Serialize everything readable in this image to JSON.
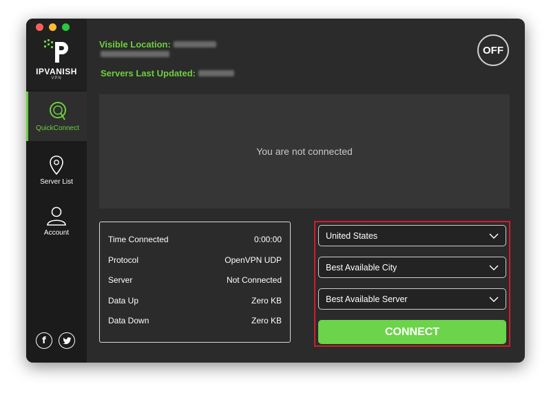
{
  "window": {
    "controls": [
      "close",
      "minimize",
      "zoom"
    ]
  },
  "brand": {
    "name": "IPVANISH",
    "sub": "VPN",
    "accent": "#6fcf3f"
  },
  "sidebar": {
    "items": [
      {
        "label": "QuickConnect",
        "icon": "quickconnect-icon",
        "active": true
      },
      {
        "label": "Server List",
        "icon": "location-pin-icon",
        "active": false
      },
      {
        "label": "Account",
        "icon": "user-icon",
        "active": false
      }
    ],
    "social": [
      {
        "icon": "facebook-icon",
        "glyph": "f"
      },
      {
        "icon": "twitter-icon",
        "glyph": "🐦"
      }
    ]
  },
  "header": {
    "visible_location_label": "Visible Location:",
    "servers_updated_label": "Servers Last Updated:",
    "power_label": "OFF"
  },
  "status": {
    "message": "You are not connected"
  },
  "stats": [
    {
      "label": "Time Connected",
      "value": "0:00:00"
    },
    {
      "label": "Protocol",
      "value": "OpenVPN UDP"
    },
    {
      "label": "Server",
      "value": "Not Connected"
    },
    {
      "label": "Data Up",
      "value": "Zero KB"
    },
    {
      "label": "Data Down",
      "value": "Zero KB"
    }
  ],
  "controls": {
    "country": "United States",
    "city": "Best Available City",
    "server": "Best Available Server",
    "connect_label": "CONNECT",
    "highlight_color": "#d11e2a",
    "connect_color": "#6cd44a"
  }
}
